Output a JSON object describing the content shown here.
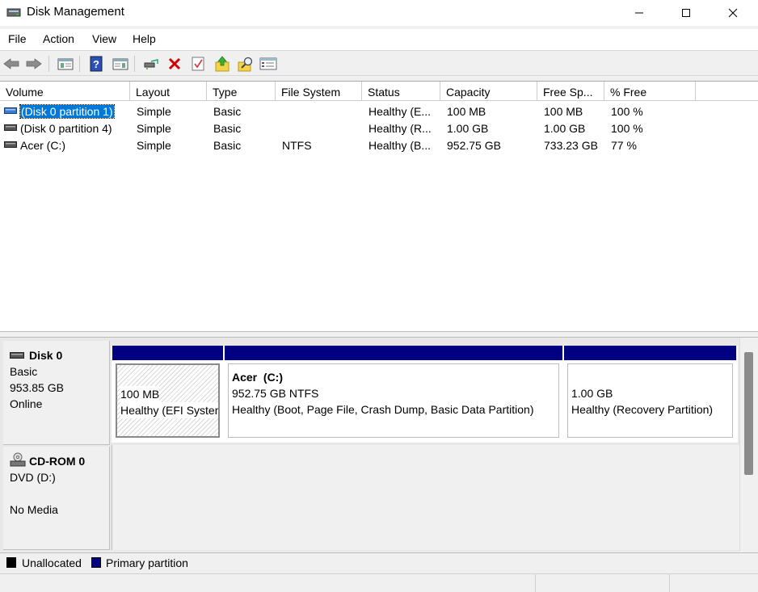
{
  "window": {
    "title": "Disk Management",
    "minimize_icon": "minimize-icon",
    "maximize_icon": "maximize-icon",
    "close_icon": "close-icon"
  },
  "menu": [
    "File",
    "Action",
    "View",
    "Help"
  ],
  "toolbar": {
    "buttons": [
      "back-arrow-icon",
      "forward-arrow-icon",
      "console-tree-icon",
      "help-icon",
      "properties-pane-icon",
      "connect-drive-icon",
      "delete-icon",
      "checklist-icon",
      "upload-folder-icon",
      "search-folder-icon",
      "list-view-icon"
    ]
  },
  "volume_list": {
    "columns": [
      "Volume",
      "Layout",
      "Type",
      "File System",
      "Status",
      "Capacity",
      "Free Sp...",
      "% Free"
    ],
    "rows": [
      {
        "volume": "(Disk 0 partition 1)",
        "layout": "Simple",
        "type": "Basic",
        "fs": "",
        "status": "Healthy (E...",
        "capacity": "100 MB",
        "free": "100 MB",
        "pct": "100 %",
        "selected": true
      },
      {
        "volume": "(Disk 0 partition 4)",
        "layout": "Simple",
        "type": "Basic",
        "fs": "",
        "status": "Healthy (R...",
        "capacity": "1.00 GB",
        "free": "1.00 GB",
        "pct": "100 %",
        "selected": false
      },
      {
        "volume": "Acer (C:)",
        "layout": "Simple",
        "type": "Basic",
        "fs": "NTFS",
        "status": "Healthy (B...",
        "capacity": "952.75 GB",
        "free": "733.23 GB",
        "pct": "77 %",
        "selected": false
      }
    ]
  },
  "disks": [
    {
      "name": "Disk 0",
      "type": "Basic",
      "size": "953.85 GB",
      "state": "Online",
      "partitions": [
        {
          "title": "",
          "size": "100 MB",
          "status": "Healthy (EFI System Partition)"
        },
        {
          "title": "Acer  (C:)",
          "size": "952.75 GB NTFS",
          "status": "Healthy (Boot, Page File, Crash Dump, Basic Data Partition)"
        },
        {
          "title": "",
          "size": "1.00 GB",
          "status": "Healthy (Recovery Partition)"
        }
      ]
    },
    {
      "name": "CD-ROM 0",
      "type": "DVD (D:)",
      "state": "No Media"
    }
  ],
  "legend": {
    "items": [
      {
        "label": "Unallocated",
        "color": "#000000"
      },
      {
        "label": "Primary partition",
        "color": "#000080"
      }
    ]
  },
  "colors": {
    "primary_partition": "#000080",
    "selection": "#0078d7"
  }
}
